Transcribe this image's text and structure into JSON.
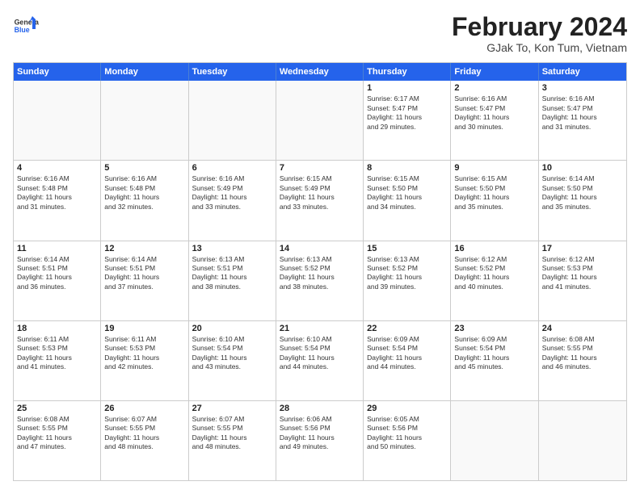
{
  "logo": {
    "line1": "General",
    "line2": "Blue"
  },
  "title": "February 2024",
  "subtitle": "GJak To, Kon Tum, Vietnam",
  "header_days": [
    "Sunday",
    "Monday",
    "Tuesday",
    "Wednesday",
    "Thursday",
    "Friday",
    "Saturday"
  ],
  "weeks": [
    [
      {
        "day": "",
        "info": ""
      },
      {
        "day": "",
        "info": ""
      },
      {
        "day": "",
        "info": ""
      },
      {
        "day": "",
        "info": ""
      },
      {
        "day": "1",
        "info": "Sunrise: 6:17 AM\nSunset: 5:47 PM\nDaylight: 11 hours\nand 29 minutes."
      },
      {
        "day": "2",
        "info": "Sunrise: 6:16 AM\nSunset: 5:47 PM\nDaylight: 11 hours\nand 30 minutes."
      },
      {
        "day": "3",
        "info": "Sunrise: 6:16 AM\nSunset: 5:47 PM\nDaylight: 11 hours\nand 31 minutes."
      }
    ],
    [
      {
        "day": "4",
        "info": "Sunrise: 6:16 AM\nSunset: 5:48 PM\nDaylight: 11 hours\nand 31 minutes."
      },
      {
        "day": "5",
        "info": "Sunrise: 6:16 AM\nSunset: 5:48 PM\nDaylight: 11 hours\nand 32 minutes."
      },
      {
        "day": "6",
        "info": "Sunrise: 6:16 AM\nSunset: 5:49 PM\nDaylight: 11 hours\nand 33 minutes."
      },
      {
        "day": "7",
        "info": "Sunrise: 6:15 AM\nSunset: 5:49 PM\nDaylight: 11 hours\nand 33 minutes."
      },
      {
        "day": "8",
        "info": "Sunrise: 6:15 AM\nSunset: 5:50 PM\nDaylight: 11 hours\nand 34 minutes."
      },
      {
        "day": "9",
        "info": "Sunrise: 6:15 AM\nSunset: 5:50 PM\nDaylight: 11 hours\nand 35 minutes."
      },
      {
        "day": "10",
        "info": "Sunrise: 6:14 AM\nSunset: 5:50 PM\nDaylight: 11 hours\nand 35 minutes."
      }
    ],
    [
      {
        "day": "11",
        "info": "Sunrise: 6:14 AM\nSunset: 5:51 PM\nDaylight: 11 hours\nand 36 minutes."
      },
      {
        "day": "12",
        "info": "Sunrise: 6:14 AM\nSunset: 5:51 PM\nDaylight: 11 hours\nand 37 minutes."
      },
      {
        "day": "13",
        "info": "Sunrise: 6:13 AM\nSunset: 5:51 PM\nDaylight: 11 hours\nand 38 minutes."
      },
      {
        "day": "14",
        "info": "Sunrise: 6:13 AM\nSunset: 5:52 PM\nDaylight: 11 hours\nand 38 minutes."
      },
      {
        "day": "15",
        "info": "Sunrise: 6:13 AM\nSunset: 5:52 PM\nDaylight: 11 hours\nand 39 minutes."
      },
      {
        "day": "16",
        "info": "Sunrise: 6:12 AM\nSunset: 5:52 PM\nDaylight: 11 hours\nand 40 minutes."
      },
      {
        "day": "17",
        "info": "Sunrise: 6:12 AM\nSunset: 5:53 PM\nDaylight: 11 hours\nand 41 minutes."
      }
    ],
    [
      {
        "day": "18",
        "info": "Sunrise: 6:11 AM\nSunset: 5:53 PM\nDaylight: 11 hours\nand 41 minutes."
      },
      {
        "day": "19",
        "info": "Sunrise: 6:11 AM\nSunset: 5:53 PM\nDaylight: 11 hours\nand 42 minutes."
      },
      {
        "day": "20",
        "info": "Sunrise: 6:10 AM\nSunset: 5:54 PM\nDaylight: 11 hours\nand 43 minutes."
      },
      {
        "day": "21",
        "info": "Sunrise: 6:10 AM\nSunset: 5:54 PM\nDaylight: 11 hours\nand 44 minutes."
      },
      {
        "day": "22",
        "info": "Sunrise: 6:09 AM\nSunset: 5:54 PM\nDaylight: 11 hours\nand 44 minutes."
      },
      {
        "day": "23",
        "info": "Sunrise: 6:09 AM\nSunset: 5:54 PM\nDaylight: 11 hours\nand 45 minutes."
      },
      {
        "day": "24",
        "info": "Sunrise: 6:08 AM\nSunset: 5:55 PM\nDaylight: 11 hours\nand 46 minutes."
      }
    ],
    [
      {
        "day": "25",
        "info": "Sunrise: 6:08 AM\nSunset: 5:55 PM\nDaylight: 11 hours\nand 47 minutes."
      },
      {
        "day": "26",
        "info": "Sunrise: 6:07 AM\nSunset: 5:55 PM\nDaylight: 11 hours\nand 48 minutes."
      },
      {
        "day": "27",
        "info": "Sunrise: 6:07 AM\nSunset: 5:55 PM\nDaylight: 11 hours\nand 48 minutes."
      },
      {
        "day": "28",
        "info": "Sunrise: 6:06 AM\nSunset: 5:56 PM\nDaylight: 11 hours\nand 49 minutes."
      },
      {
        "day": "29",
        "info": "Sunrise: 6:05 AM\nSunset: 5:56 PM\nDaylight: 11 hours\nand 50 minutes."
      },
      {
        "day": "",
        "info": ""
      },
      {
        "day": "",
        "info": ""
      }
    ]
  ]
}
